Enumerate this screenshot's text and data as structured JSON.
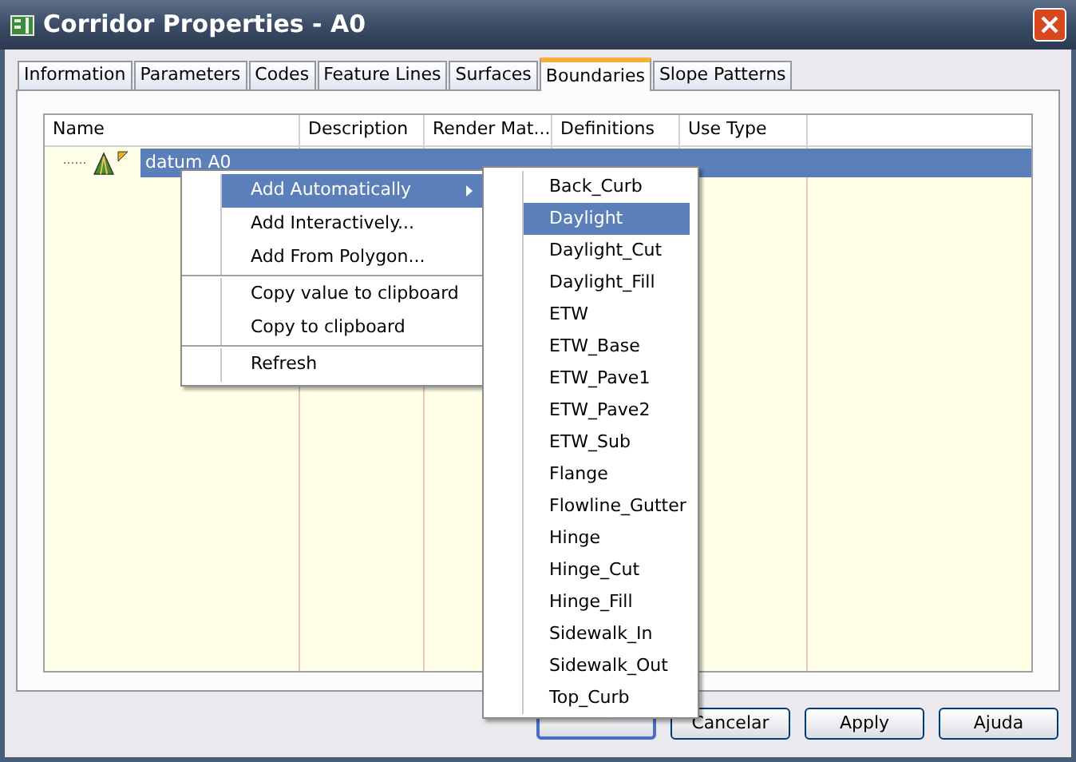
{
  "window": {
    "title": "Corridor Properties - A0"
  },
  "tabs": [
    {
      "label": "Information",
      "selected": false
    },
    {
      "label": "Parameters",
      "selected": false
    },
    {
      "label": "Codes",
      "selected": false
    },
    {
      "label": "Feature Lines",
      "selected": false
    },
    {
      "label": "Surfaces",
      "selected": false
    },
    {
      "label": "Boundaries",
      "selected": true
    },
    {
      "label": "Slope Patterns",
      "selected": false
    }
  ],
  "table": {
    "columns": [
      "Name",
      "Description",
      "Render Mat...",
      "Definitions",
      "Use Type"
    ],
    "rows": [
      {
        "name": "datum A0",
        "selected": true
      }
    ]
  },
  "context_menu": {
    "groups": [
      [
        {
          "label": "Add Automatically",
          "submenu": true,
          "selected": true
        },
        {
          "label": "Add Interactively...",
          "submenu": false,
          "selected": false
        },
        {
          "label": "Add From Polygon...",
          "submenu": false,
          "selected": false
        }
      ],
      [
        {
          "label": "Copy value to clipboard",
          "submenu": false,
          "selected": false
        },
        {
          "label": "Copy to clipboard",
          "submenu": false,
          "selected": false
        }
      ],
      [
        {
          "label": "Refresh",
          "submenu": false,
          "selected": false
        }
      ]
    ]
  },
  "submenu": {
    "items": [
      {
        "label": "Back_Curb",
        "selected": false
      },
      {
        "label": "Daylight",
        "selected": true
      },
      {
        "label": "Daylight_Cut",
        "selected": false
      },
      {
        "label": "Daylight_Fill",
        "selected": false
      },
      {
        "label": "ETW",
        "selected": false
      },
      {
        "label": "ETW_Base",
        "selected": false
      },
      {
        "label": "ETW_Pave1",
        "selected": false
      },
      {
        "label": "ETW_Pave2",
        "selected": false
      },
      {
        "label": "ETW_Sub",
        "selected": false
      },
      {
        "label": "Flange",
        "selected": false
      },
      {
        "label": "Flowline_Gutter",
        "selected": false
      },
      {
        "label": "Hinge",
        "selected": false
      },
      {
        "label": "Hinge_Cut",
        "selected": false
      },
      {
        "label": "Hinge_Fill",
        "selected": false
      },
      {
        "label": "Sidewalk_In",
        "selected": false
      },
      {
        "label": "Sidewalk_Out",
        "selected": false
      },
      {
        "label": "Top_Curb",
        "selected": false
      }
    ]
  },
  "buttons": [
    {
      "default": true
    },
    {
      "label": "Cancelar",
      "default": false
    },
    {
      "label": "Apply",
      "default": false
    },
    {
      "label": "Ajuda",
      "default": false
    }
  ]
}
